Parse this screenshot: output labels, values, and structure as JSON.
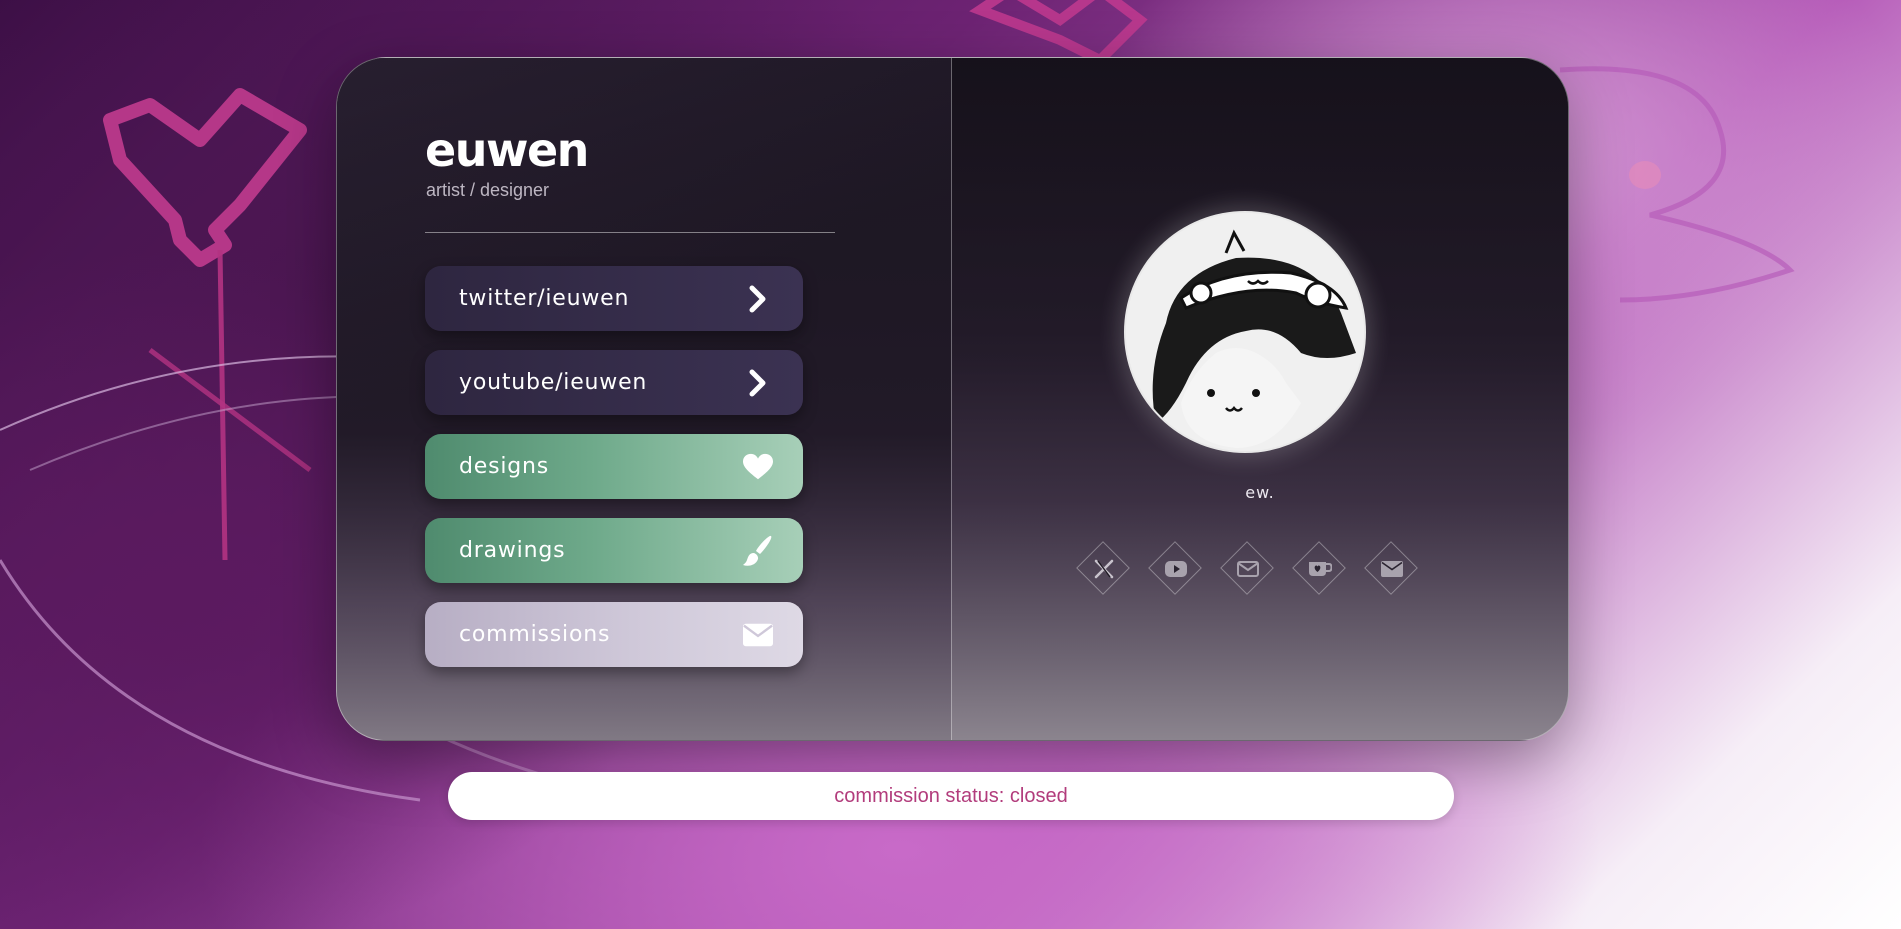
{
  "profile": {
    "name": "euwen",
    "tagline": "artist / designer",
    "avatar_caption": "ew."
  },
  "links": [
    {
      "label": "twitter/ieuwen",
      "icon": "chevron-right-icon",
      "style": "dark"
    },
    {
      "label": "youtube/ieuwen",
      "icon": "chevron-right-icon",
      "style": "dark"
    },
    {
      "label": "designs",
      "icon": "heart-icon",
      "style": "green"
    },
    {
      "label": "drawings",
      "icon": "paintbrush-icon",
      "style": "green"
    },
    {
      "label": "commissions",
      "icon": "envelope-icon",
      "style": "lilac"
    }
  ],
  "socials": [
    {
      "icon": "x-twitter-icon"
    },
    {
      "icon": "youtube-icon"
    },
    {
      "icon": "mail-outline-icon"
    },
    {
      "icon": "ko-fi-cup-icon"
    },
    {
      "icon": "envelope-icon"
    }
  ],
  "status": {
    "text": "commission status: closed"
  },
  "colors": {
    "accent_pink": "#b23c7c",
    "button_dark": "#352c49",
    "button_green": "#6faa8b",
    "button_lilac": "#cfc8d9"
  }
}
